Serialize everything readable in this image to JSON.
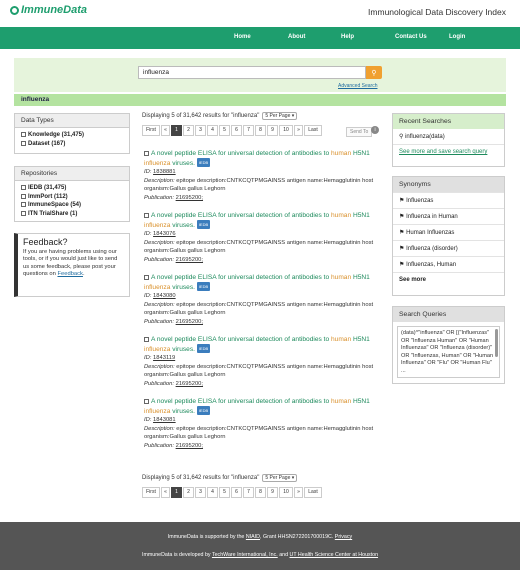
{
  "header": {
    "logo": "ImmuneData",
    "site_title": "Immunological Data Discovery Index"
  },
  "nav": {
    "items": [
      "Home",
      "About",
      "Help",
      "Contact Us",
      "Login"
    ]
  },
  "search": {
    "value": "influenza",
    "advanced": "Advanced Search",
    "query_label": "influenza"
  },
  "data_types": {
    "title": "Data Types",
    "items": [
      "Knowledge (31,475)",
      "Dataset (167)"
    ]
  },
  "repositories": {
    "title": "Repositories",
    "items": [
      "IEDB (31,475)",
      "ImmPort (112)",
      "ImmuneSpace (54)",
      "ITN TrialShare (1)"
    ]
  },
  "feedback": {
    "title": "Feedback?",
    "text": "If you are having problems using our tools, or if you would just like to send us some feedback, please post your questions on ",
    "link": "Feedback",
    "end": "."
  },
  "results": {
    "display_text": "Displaying 5 of 31,642 results for \"influenza\"",
    "per_page": "5 Per Page",
    "pager": [
      "First",
      "«",
      "1",
      "2",
      "3",
      "4",
      "5",
      "6",
      "7",
      "8",
      "9",
      "10",
      "»",
      "Last"
    ],
    "send_to": "Send To",
    "labels": {
      "id": "ID:",
      "description": "Description:",
      "publication": "Publication:"
    },
    "items": [
      {
        "title_a": "A novel peptide ELISA for universal detection of antibodies to ",
        "title_hl1": "human",
        "title_b": " H5N1 ",
        "title_hl2": "influenza",
        "title_c": " viruses.",
        "badge": "IEDB",
        "id": "1838881",
        "description": "epitope description:CNTKCQTPMGAINSS antigen name:Hemagglutinin host organism:Gallus gallus Leghorn",
        "publication": "21695200;"
      },
      {
        "title_a": "A novel peptide ELISA for universal detection of antibodies to ",
        "title_hl1": "human",
        "title_b": " H5N1 ",
        "title_hl2": "influenza",
        "title_c": " viruses.",
        "badge": "IEDB",
        "id": "1843076",
        "description": "epitope description:CNTKCQTPMGAINSS antigen name:Hemagglutinin host organism:Gallus gallus Leghorn",
        "publication": "21695200;"
      },
      {
        "title_a": "A novel peptide ELISA for universal detection of antibodies to ",
        "title_hl1": "human",
        "title_b": " H5N1 ",
        "title_hl2": "influenza",
        "title_c": " viruses.",
        "badge": "IEDB",
        "id": "1843080",
        "description": "epitope description:CNTKCQTPMGAINSS antigen name:Hemagglutinin host organism:Gallus gallus Leghorn",
        "publication": "21695200;"
      },
      {
        "title_a": "A novel peptide ELISA for universal detection of antibodies to ",
        "title_hl1": "human",
        "title_b": " H5N1 ",
        "title_hl2": "influenza",
        "title_c": " viruses.",
        "badge": "IEDB",
        "id": "1843119",
        "description": "epitope description:CNTKCQTPMGAINSS antigen name:Hemagglutinin host organism:Gallus gallus Leghorn",
        "publication": "21695200;"
      },
      {
        "title_a": "A novel peptide ELISA for universal detection of antibodies to ",
        "title_hl1": "human",
        "title_b": " H5N1 ",
        "title_hl2": "influenza",
        "title_c": " viruses.",
        "badge": "IEDB",
        "id": "1843081",
        "description": "epitope description:CNTKCQTPMGAINSS antigen name:Hemagglutinin host organism:Gallus gallus Leghorn",
        "publication": "21695200;"
      }
    ]
  },
  "recent": {
    "title": "Recent Searches",
    "item": "influenza(data)",
    "link": "See more and save search query"
  },
  "synonyms": {
    "title": "Synonyms",
    "items": [
      "Influenzas",
      "Influenza in Human",
      "Human Influenzas",
      "Influenza (disorder)",
      "Influenzas, Human"
    ],
    "more": "See more"
  },
  "search_queries": {
    "title": "Search Queries",
    "text": "(data)^\"influenza\" OR [(\"Influenzas\" OR \"Influenza Human\" OR \"Human Influenzas\" OR \"Influenza (disorder)\" OR \"Influenzas, Human\" OR \"Human Influenza\" OR \"Flu\" OR \"Human Flu\" ..."
  },
  "footer": {
    "line1_a": "ImmuneData is supported by the ",
    "line1_link1": "NIAID",
    "line1_b": ", Grant HHSN272201700019C. ",
    "line1_link2": "Privacy",
    "line2_a": "ImmuneData is developed by ",
    "line2_link1": "TechWare International, Inc.",
    "line2_b": " and ",
    "line2_link2": "UT Health Science Center at Houston"
  }
}
